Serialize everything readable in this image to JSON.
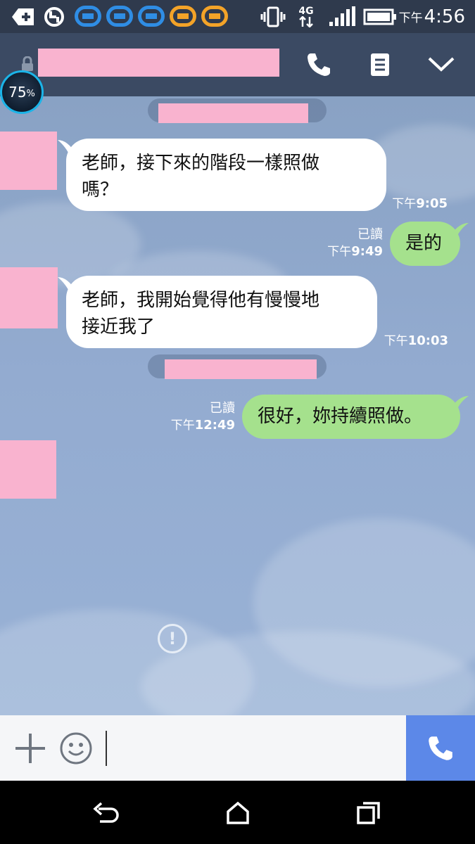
{
  "status_bar": {
    "network": "4G",
    "time_ampm": "下午",
    "time": "4:56",
    "logo_colors": [
      "#2f8de4",
      "#2f8de4",
      "#2f8de4",
      "#f3a328",
      "#f3a328"
    ]
  },
  "header": {
    "title_redacted": true,
    "icons": [
      "phone-icon",
      "notes-icon",
      "chevron-down-icon"
    ]
  },
  "battery_badge": {
    "value": "75",
    "unit": "%"
  },
  "messages": [
    {
      "side": "in",
      "text_line1": "老師，接下來的階段一樣照做",
      "text_line2": "嗎？",
      "ampm": "下午",
      "time": "9:05"
    },
    {
      "side": "out",
      "text": "是的",
      "read": "已讀",
      "ampm": "下午",
      "time": "9:49"
    },
    {
      "side": "in",
      "text_line1": "老師，我開始覺得他有慢慢地",
      "text_line2": "接近我了",
      "ampm": "下午",
      "time": "10:03"
    },
    {
      "side": "out",
      "text": "很好，妳持續照做。",
      "read": "已讀",
      "ampm": "下午",
      "time": "12:49"
    }
  ],
  "input_bar": {
    "icons": [
      "plus-icon",
      "emoji-icon",
      "call-icon"
    ],
    "value": ""
  },
  "nav_bar": {
    "icons": [
      "back-icon",
      "home-icon",
      "recents-icon"
    ]
  },
  "colors": {
    "bubble_out": "#a5e18d",
    "bubble_in": "#ffffff",
    "call_button": "#5c88e8",
    "redaction": "#f9b3cf"
  }
}
